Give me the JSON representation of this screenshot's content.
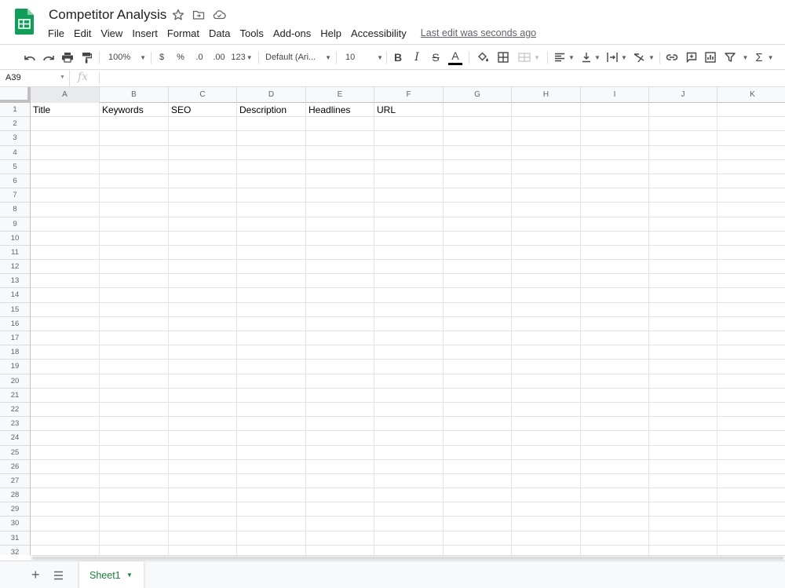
{
  "app": {
    "doc_title": "Competitor Analysis",
    "icons": [
      "sheets-logo-icon",
      "star-icon",
      "move-to-folder-icon",
      "cloud-saved-icon"
    ]
  },
  "menu": {
    "items": [
      "File",
      "Edit",
      "View",
      "Insert",
      "Format",
      "Data",
      "Tools",
      "Add-ons",
      "Help",
      "Accessibility"
    ],
    "last_edit": "Last edit was seconds ago"
  },
  "toolbar": {
    "zoom": "100%",
    "currency": "$",
    "percent": "%",
    "decrease_decimals": ".0",
    "increase_decimals": ".00",
    "more_formats": "123",
    "font": "Default (Ari...",
    "font_size": "10",
    "bold": "B",
    "italic": "I",
    "strikethrough": "S",
    "text_color": "A",
    "sum": "Σ"
  },
  "formula_bar": {
    "name_box": "A39",
    "fx": "fx",
    "value": ""
  },
  "grid": {
    "columns": [
      "A",
      "B",
      "C",
      "D",
      "E",
      "F",
      "G",
      "H",
      "I",
      "J",
      "K"
    ],
    "rows": [
      "1",
      "2",
      "3",
      "4",
      "5",
      "6",
      "7",
      "8",
      "9",
      "10",
      "11",
      "12",
      "13",
      "14",
      "15",
      "16",
      "17",
      "18",
      "19",
      "20",
      "21",
      "22",
      "23",
      "24",
      "25",
      "26",
      "27",
      "28",
      "29",
      "30",
      "31",
      "32"
    ],
    "row1": [
      "Title",
      "Keywords",
      "SEO",
      "Description",
      "Headlines",
      "URL",
      "",
      "",
      "",
      "",
      ""
    ]
  },
  "sheets": {
    "add": "+",
    "tabs": [
      "Sheet1"
    ]
  },
  "colors": {
    "accent_green": "#188038",
    "sheets_green": "#0f9d58",
    "grid_line": "#e2e3e3",
    "header_bg": "#f8f9fa"
  }
}
